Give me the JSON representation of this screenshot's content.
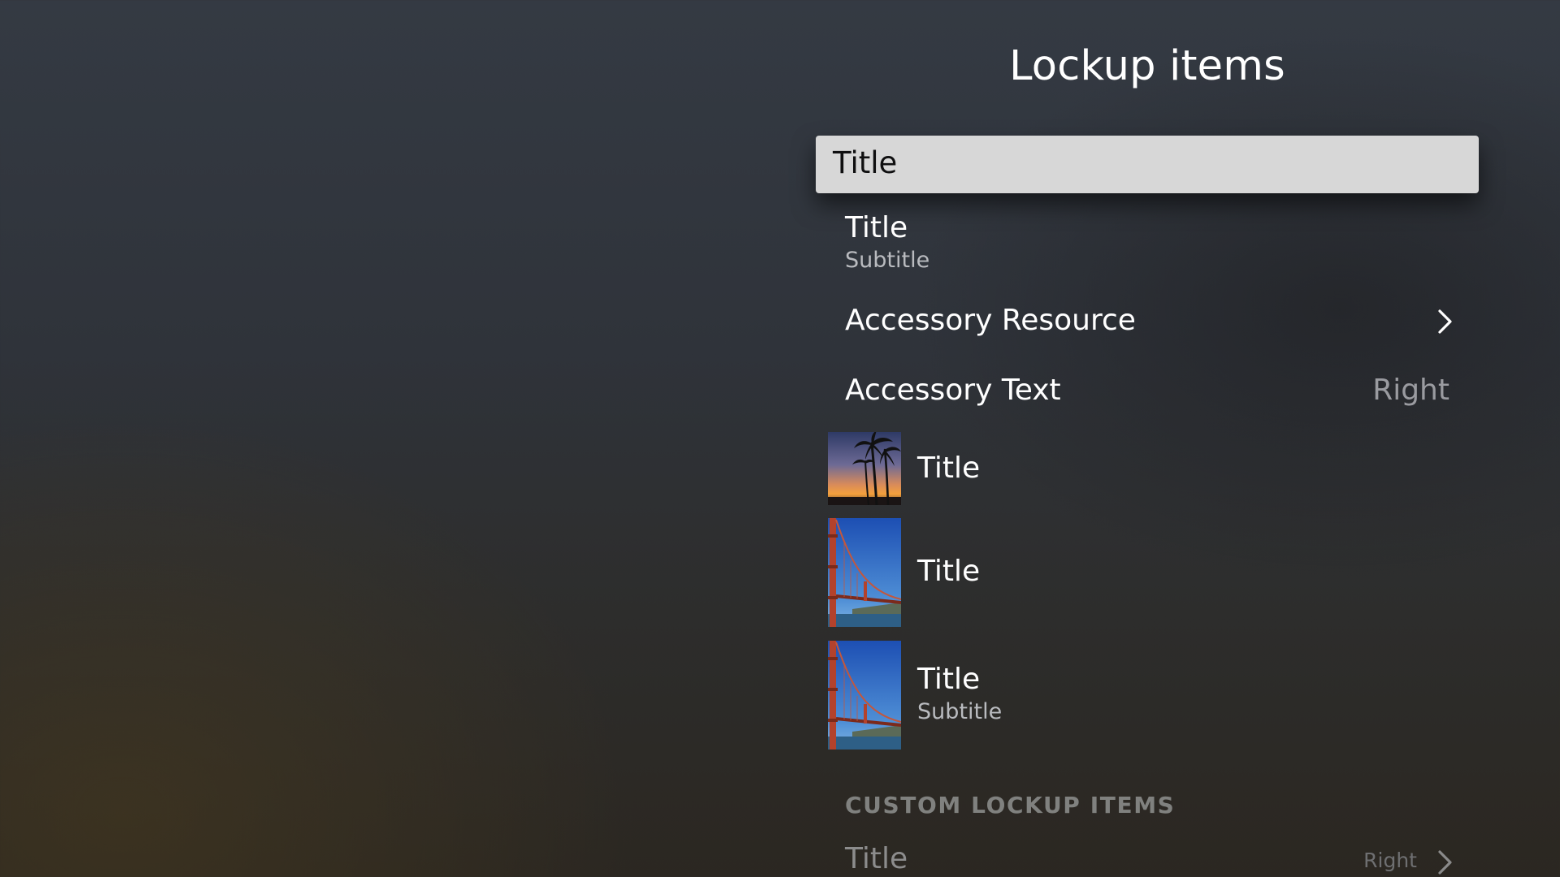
{
  "page": {
    "title": "Lockup items"
  },
  "lockup_items": [
    {
      "title": "Title",
      "state": "focused"
    },
    {
      "title": "Title",
      "subtitle": "Subtitle"
    },
    {
      "title": "Accessory Resource",
      "accessory_icon": "chevron-right-icon"
    },
    {
      "title": "Accessory Text",
      "accessory_text": "Right"
    },
    {
      "title": "Title",
      "image": "palm-trees-sunset-image"
    },
    {
      "title": "Title",
      "image": "golden-gate-bridge-image"
    },
    {
      "title": "Title",
      "subtitle": "Subtitle",
      "image": "golden-gate-bridge-image"
    }
  ],
  "custom_section": {
    "header": "CUSTOM LOCKUP ITEMS",
    "items": [
      {
        "title": "Title",
        "accessory_text": "Right",
        "accessory_icon": "chevron-right-icon"
      }
    ]
  },
  "colors": {
    "focused_background": "#d7d7d7",
    "focused_text": "#0f0f10",
    "primary_text": "#ffffff",
    "secondary_text": "#b9bbbf",
    "accessory_text": "#9a9ba0",
    "section_header": "#80817f"
  }
}
